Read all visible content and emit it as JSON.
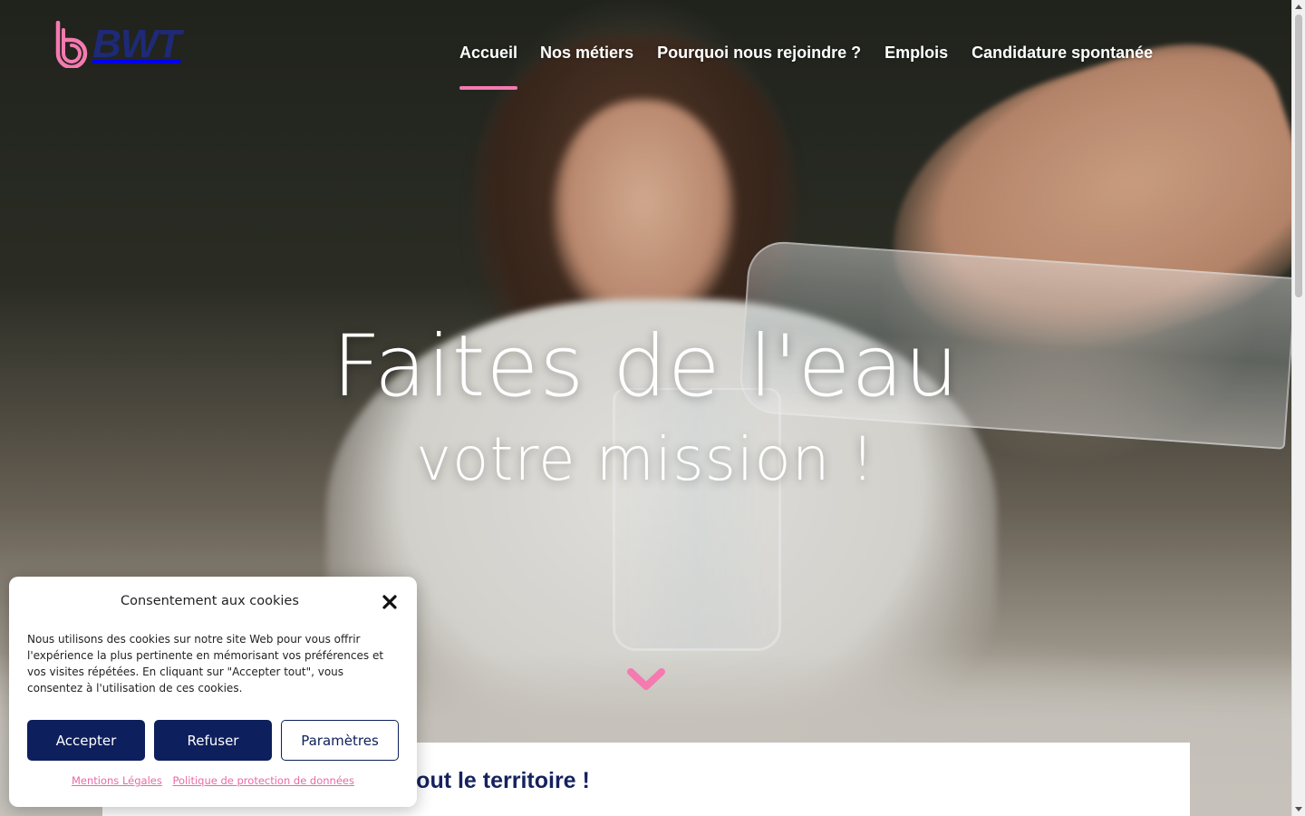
{
  "brand": {
    "name": "BWT",
    "logo_icon": "bwt-swirl-logo-icon",
    "primary_color": "#1e2a78",
    "accent_color": "#f47ab0"
  },
  "nav": {
    "items": [
      {
        "label": "Accueil",
        "active": true
      },
      {
        "label": "Nos métiers",
        "active": false
      },
      {
        "label": "Pourquoi nous rejoindre ?",
        "active": false
      },
      {
        "label": "Emplois",
        "active": false
      },
      {
        "label": "Candidature spontanée",
        "active": false
      }
    ]
  },
  "hero": {
    "line1": "Faites de l'eau",
    "line2": "votre mission !",
    "scroll_icon": "chevron-down-icon"
  },
  "section": {
    "heading": "sur tout le territoire !"
  },
  "cookie": {
    "title": "Consentement aux cookies",
    "close_icon": "close-icon",
    "text": "Nous utilisons des cookies sur notre site Web pour vous offrir l'expérience la plus pertinente en mémorisant vos préférences et vos visites répétées. En cliquant sur \"Accepter tout\", vous consentez à l'utilisation de ces cookies.",
    "buttons": {
      "accept": "Accepter",
      "refuse": "Refuser",
      "settings": "Paramètres"
    },
    "links": {
      "legal": "Mentions Légales",
      "privacy": "Politique de protection de données"
    },
    "button_color": "#0d1f5c",
    "link_color": "#e86aa6"
  }
}
